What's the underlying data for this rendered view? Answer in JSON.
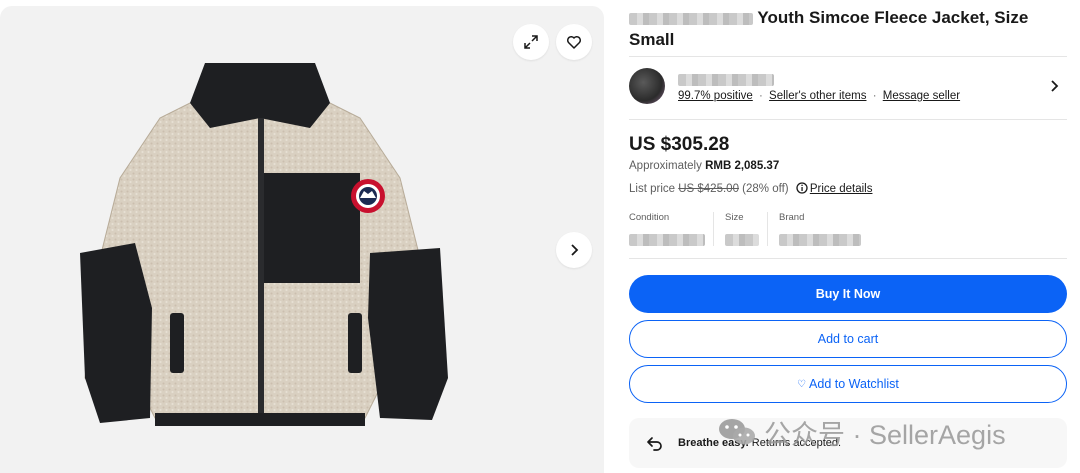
{
  "gallery": {
    "expand_icon": "expand-icon",
    "heart_icon": "heart-icon",
    "next_icon": "chevron-right-icon",
    "image_alt": "Canada Goose Youth Simcoe Fleece Jacket"
  },
  "product": {
    "title_visible": "Youth Simcoe Fleece Jacket, Size Small",
    "price": "US $305.28",
    "approx_prefix": "Approximately ",
    "approx_value": "RMB 2,085.37",
    "list_price_label": "List price ",
    "list_price_old": "US $425.00",
    "discount": " (28% off) ",
    "price_details_link": "Price details"
  },
  "seller": {
    "positive": "99.7% positive",
    "other_items": "Seller's other items",
    "message": "Message seller",
    "separator": "·"
  },
  "specs": [
    {
      "label": "Condition"
    },
    {
      "label": "Size"
    },
    {
      "label": "Brand"
    }
  ],
  "actions": {
    "buy_now": "Buy It Now",
    "add_to_cart": "Add to cart",
    "watchlist_heart": "♡",
    "add_to_watchlist": "Add to Watchlist"
  },
  "returns": {
    "bold": "Breathe easy.",
    "text": " Returns accepted."
  },
  "watermark": {
    "text": "公众号 · SellerAegis"
  },
  "colors": {
    "accent": "#0b63f6",
    "gallery_bg": "#f2f2f2",
    "jacket_fleece": "#d9d0c1",
    "jacket_black": "#1e1f22",
    "badge_red": "#c8102e"
  }
}
